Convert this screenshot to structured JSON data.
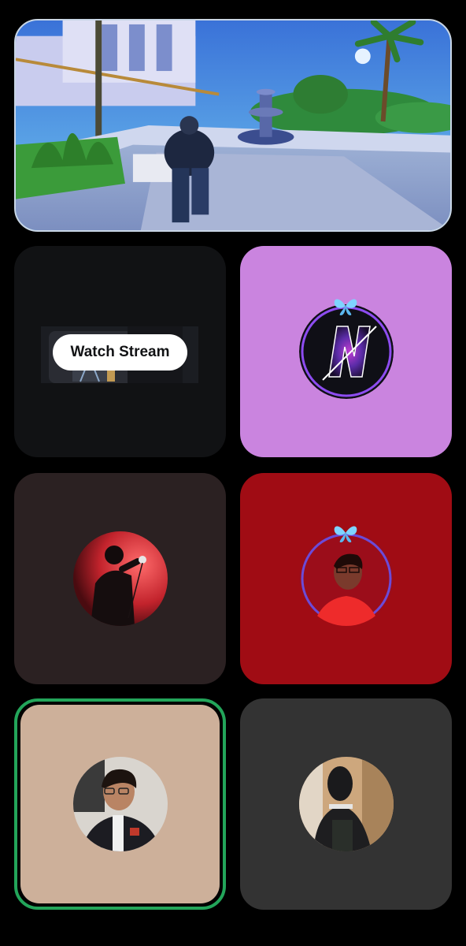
{
  "screen_share": {
    "icon": "game-screenshare"
  },
  "stream_tile": {
    "watch_label": "Watch Stream",
    "bg_color": "#111214"
  },
  "participants": [
    {
      "slot": "top-right",
      "avatar_icon": "n-logo-avatar",
      "bg_color": "#ca84df",
      "butterfly": true
    },
    {
      "slot": "middle-left",
      "avatar_icon": "singer-mic-avatar",
      "bg_color": "#2b2122",
      "butterfly": false
    },
    {
      "slot": "middle-right",
      "avatar_icon": "person-red-avatar",
      "bg_color": "#a00c14",
      "butterfly": true
    },
    {
      "slot": "bottom-left",
      "avatar_icon": "person-jacket-avatar",
      "bg_color": "#cdb09a",
      "speaking": true
    },
    {
      "slot": "bottom-right",
      "avatar_icon": "hooded-person-avatar",
      "bg_color": "#333333",
      "butterfly": false
    }
  ],
  "colors": {
    "speaking_ring": "#23a55a",
    "background": "#000000"
  }
}
